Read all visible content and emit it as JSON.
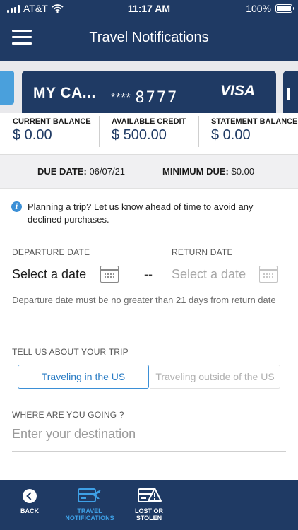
{
  "status_bar": {
    "carrier": "AT&T",
    "time": "11:17 AM",
    "battery": "100%"
  },
  "header": {
    "title": "Travel Notifications"
  },
  "card": {
    "name": "MY CA...",
    "masked": "****",
    "last4": "8777",
    "network": "VISA"
  },
  "balances": [
    {
      "label": "CURRENT BALANCE",
      "value": "$ 0.00"
    },
    {
      "label": "AVAILABLE CREDIT",
      "value": "$ 500.00"
    },
    {
      "label": "STATEMENT BALANCE",
      "value": "$ 0.00"
    }
  ],
  "due": {
    "date_label": "DUE DATE:",
    "date_value": "06/07/21",
    "min_label": "MINIMUM DUE:",
    "min_value": "$0.00"
  },
  "info": {
    "text": "Planning a trip? Let us know ahead of time to avoid any declined purchases."
  },
  "departure": {
    "label": "DEPARTURE DATE",
    "placeholder": "Select a date"
  },
  "return_date": {
    "label": "RETURN DATE",
    "placeholder": "Select a date"
  },
  "separator": "--",
  "hint": "Departure date must be no greater than 21 days from return date",
  "trip": {
    "label": "TELL US ABOUT YOUR TRIP",
    "option_us": "Traveling in the US",
    "option_outside": "Traveling outside of the US"
  },
  "destination": {
    "label": "WHERE ARE YOU GOING ?",
    "placeholder": "Enter your destination"
  },
  "nav": {
    "back": "BACK",
    "travel": "TRAVEL NOTIFICATIONS",
    "lost": "LOST OR STOLEN"
  },
  "colors": {
    "primary": "#1f3a64",
    "accent": "#3b8fd6",
    "active_nav": "#3ea0e6"
  }
}
